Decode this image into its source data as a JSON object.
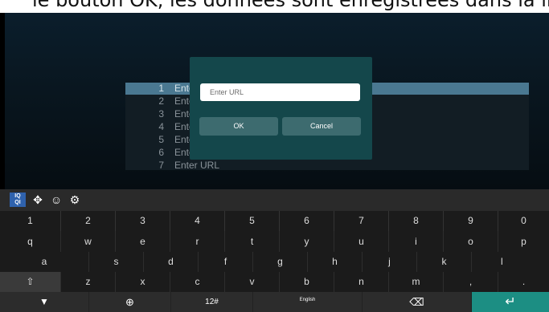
{
  "caption": {
    "text": "le bouton OK, les données sont enregistrées dans la liste."
  },
  "url_list": {
    "rows": [
      {
        "num": "1",
        "label": "Ente"
      },
      {
        "num": "2",
        "label": "Ente"
      },
      {
        "num": "3",
        "label": "Ente"
      },
      {
        "num": "4",
        "label": "Ente"
      },
      {
        "num": "5",
        "label": "Ente"
      },
      {
        "num": "6",
        "label": "Ente"
      },
      {
        "num": "7",
        "label": "Enter URL"
      }
    ],
    "selected_row": 1
  },
  "dialog": {
    "input_placeholder": "Enter URL",
    "ok_label": "OK",
    "cancel_label": "Cancel"
  },
  "ime_toolbar": {
    "logo_text_top": "IQ",
    "logo_text_bottom": "QI",
    "icons": [
      "ime-logo-icon",
      "move-icon",
      "emoji-icon",
      "settings-icon"
    ]
  },
  "keyboard": {
    "digits": [
      "1",
      "2",
      "3",
      "4",
      "5",
      "6",
      "7",
      "8",
      "9",
      "0"
    ],
    "row1": [
      "q",
      "w",
      "e",
      "r",
      "t",
      "y",
      "u",
      "i",
      "o",
      "p"
    ],
    "row2": [
      "a",
      "s",
      "d",
      "f",
      "g",
      "h",
      "j",
      "k",
      "l"
    ],
    "row3": [
      "z",
      "x",
      "c",
      "v",
      "b",
      "n",
      "m",
      ",",
      "."
    ],
    "symbols_label": "12#",
    "language_label": "English",
    "colors": {
      "enter_key": "#1c8e83",
      "dialog": "#14474b",
      "ime_logo": "#2f62ad"
    }
  }
}
